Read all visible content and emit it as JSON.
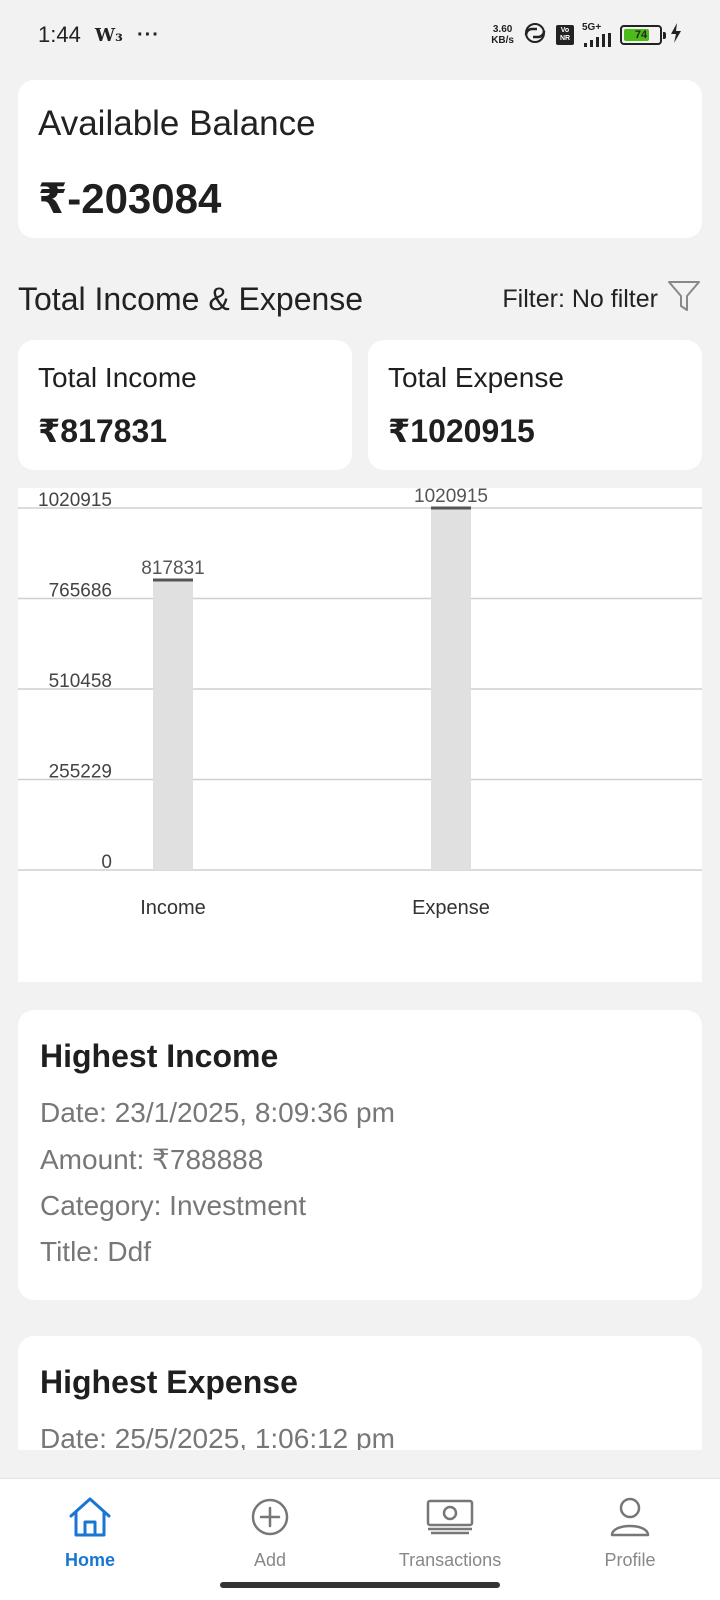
{
  "status_bar": {
    "time": "1:44",
    "notif_icon": "W₃",
    "more": "···",
    "net_speed_value": "3.60",
    "net_speed_unit": "KB/s",
    "volte_top": "Vo",
    "volte_bottom": "NR",
    "network": "5G+",
    "battery": "74"
  },
  "balance": {
    "label": "Available Balance",
    "value": "₹-203084"
  },
  "section": {
    "title": "Total Income & Expense",
    "filter_label": "Filter: No filter"
  },
  "totals": {
    "income_label": "Total Income",
    "income_value": "₹817831",
    "expense_label": "Total Expense",
    "expense_value": "₹1020915"
  },
  "chart_data": {
    "type": "bar",
    "categories": [
      "Income",
      "Expense"
    ],
    "values": [
      817831,
      1020915
    ],
    "data_labels": [
      "817831",
      "1020915"
    ],
    "yticks": [
      0,
      255229,
      510458,
      765686,
      1020915
    ],
    "ylim": [
      0,
      1020915
    ],
    "grid": true,
    "bar_color": "#e0e0e0",
    "top_line_color": "#555555"
  },
  "highest_income": {
    "title": "Highest Income",
    "date": "Date: 23/1/2025, 8:09:36 pm",
    "amount": "Amount: ₹788888",
    "category": "Category: Investment",
    "title_line": "Title: Ddf"
  },
  "highest_expense": {
    "title": "Highest Expense",
    "date": "Date: 25/5/2025, 1:06:12 pm"
  },
  "nav": {
    "items": [
      {
        "label": "Home",
        "icon": "home-icon"
      },
      {
        "label": "Add",
        "icon": "add-circle-icon"
      },
      {
        "label": "Transactions",
        "icon": "cash-icon"
      },
      {
        "label": "Profile",
        "icon": "profile-icon"
      }
    ],
    "active_color": "#1976d2",
    "inactive_color": "#888888"
  }
}
